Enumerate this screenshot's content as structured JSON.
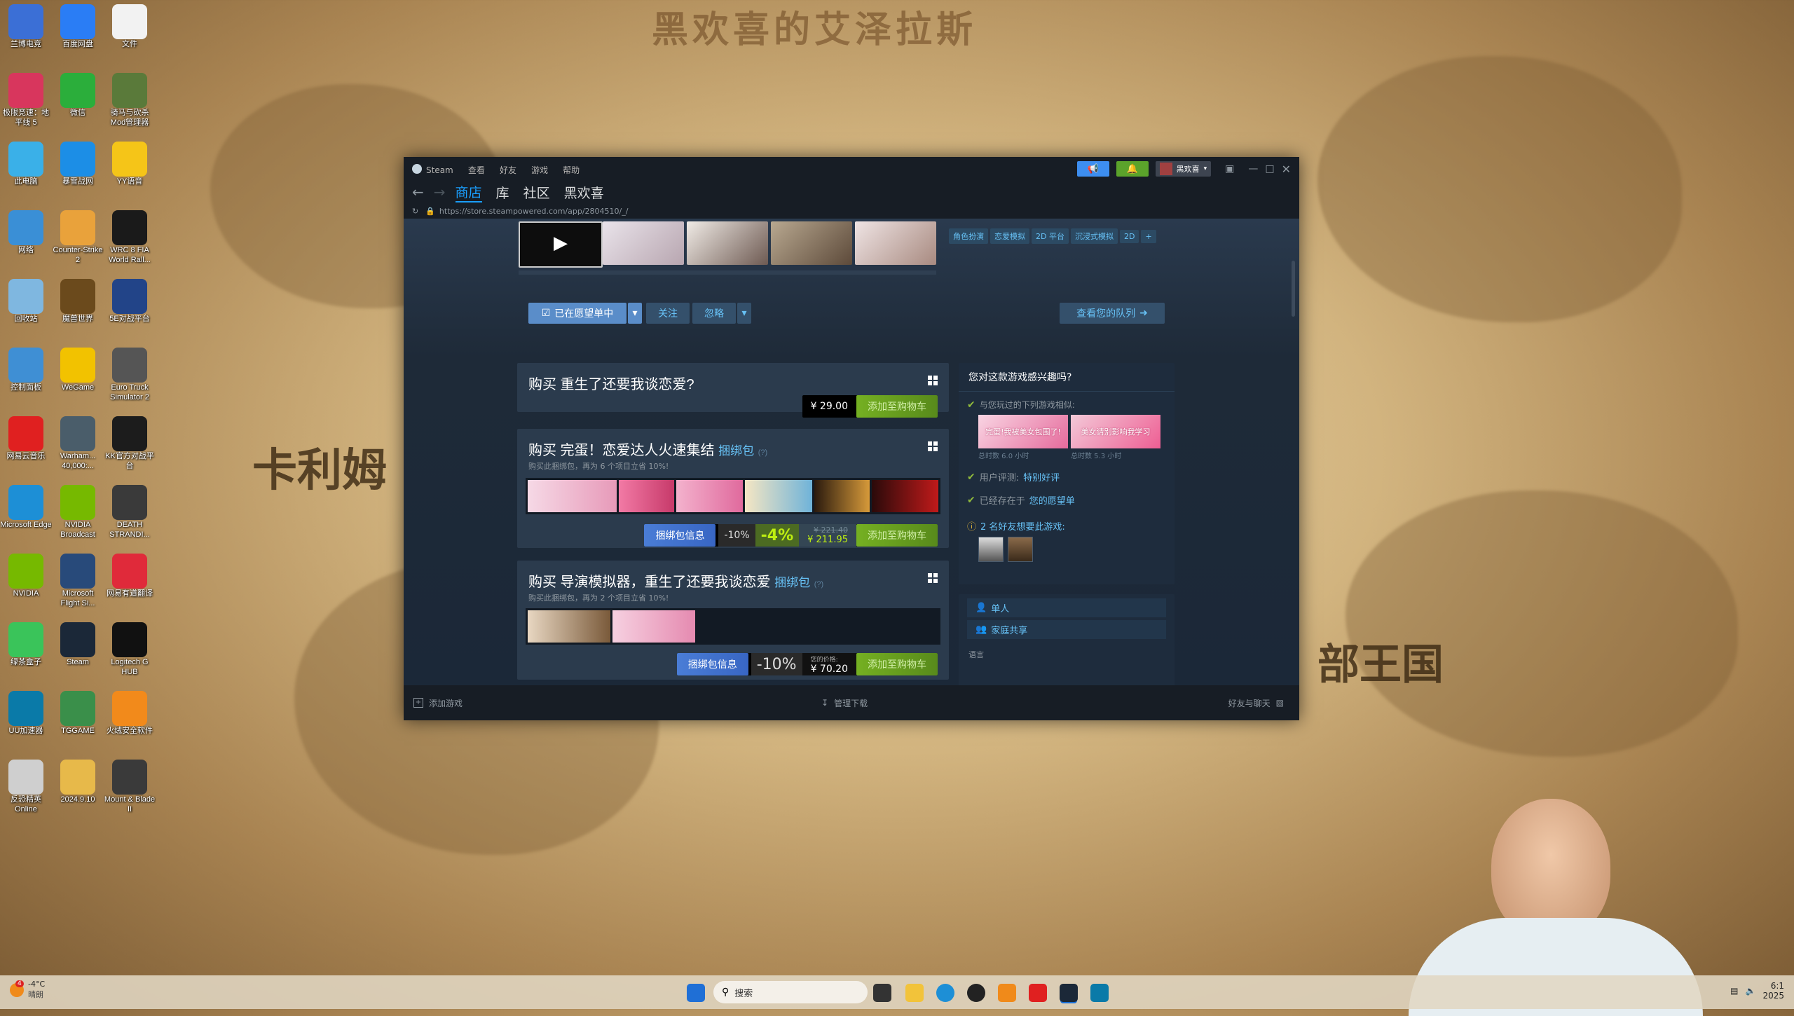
{
  "wallpaper": {
    "banner": "黑欢喜的艾泽拉斯",
    "map_labels": [
      "卡利姆",
      "部王国"
    ]
  },
  "desktop_icons": [
    {
      "label": "兰博电竞",
      "icon": "game-icon",
      "color": "#3b6fd6"
    },
    {
      "label": "百度网盘",
      "icon": "cloud-icon",
      "color": "#2a7df5"
    },
    {
      "label": "文件",
      "icon": "document-icon",
      "color": "#f2f2f2"
    },
    {
      "label": "极限竞速：地平线 5",
      "icon": "forza-icon",
      "color": "#d8365d"
    },
    {
      "label": "微信",
      "icon": "wechat-icon",
      "color": "#2bae3b"
    },
    {
      "label": "骑马与砍杀Mod管理器",
      "icon": "mod-icon",
      "color": "#5a7a3a"
    },
    {
      "label": "此电脑",
      "icon": "computer-icon",
      "color": "#3ab0e8"
    },
    {
      "label": "暴雪战网",
      "icon": "battlenet-icon",
      "color": "#1c8ee6"
    },
    {
      "label": "YY语音",
      "icon": "yy-icon",
      "color": "#f5c518"
    },
    {
      "label": "网络",
      "icon": "network-icon",
      "color": "#3a8fd6"
    },
    {
      "label": "Counter-Strike 2",
      "icon": "cs2-icon",
      "color": "#e9a23b"
    },
    {
      "label": "WRC 8 FIA World Rall...",
      "icon": "wrc-icon",
      "color": "#1a1a1a"
    },
    {
      "label": "回收站",
      "icon": "recycle-bin-icon",
      "color": "#7fb7e0"
    },
    {
      "label": "魔兽世界",
      "icon": "wow-icon",
      "color": "#6b4a1c"
    },
    {
      "label": "5E对战平台",
      "icon": "5e-icon",
      "color": "#224488"
    },
    {
      "label": "控制面板",
      "icon": "control-panel-icon",
      "color": "#3f8fd4"
    },
    {
      "label": "WeGame",
      "icon": "wegame-icon",
      "color": "#f2c200"
    },
    {
      "label": "Euro Truck Simulator 2",
      "icon": "truck-icon",
      "color": "#555"
    },
    {
      "label": "网易云音乐",
      "icon": "netease-music-icon",
      "color": "#e02020"
    },
    {
      "label": "Warham... 40,000:...",
      "icon": "warhammer-icon",
      "color": "#4a5d6a"
    },
    {
      "label": "KK官方对战平台",
      "icon": "kk-icon",
      "color": "#1c1c1c"
    },
    {
      "label": "Microsoft Edge",
      "icon": "edge-icon",
      "color": "#1d8fd6"
    },
    {
      "label": "NVIDIA Broadcast",
      "icon": "nvidia-broadcast-icon",
      "color": "#76b900"
    },
    {
      "label": "DEATH STRANDI...",
      "icon": "death-stranding-icon",
      "color": "#3a3a3a"
    },
    {
      "label": "NVIDIA",
      "icon": "nvidia-icon",
      "color": "#76b900"
    },
    {
      "label": "Microsoft Flight Si...",
      "icon": "flight-sim-icon",
      "color": "#284a7a"
    },
    {
      "label": "网易有道翻译",
      "icon": "youdao-icon",
      "color": "#e02a3a"
    },
    {
      "label": "绿茶盒子",
      "icon": "box-icon",
      "color": "#3ac45a"
    },
    {
      "label": "Steam",
      "icon": "steam-icon",
      "color": "#1b2838"
    },
    {
      "label": "Logitech G HUB",
      "icon": "logitech-icon",
      "color": "#111"
    },
    {
      "label": "UU加速器",
      "icon": "uu-icon",
      "color": "#0a7aa8"
    },
    {
      "label": "TGGAME",
      "icon": "tggame-icon",
      "color": "#3a8f4a"
    },
    {
      "label": "火绒安全软件",
      "icon": "huorong-icon",
      "color": "#f28a1b"
    },
    {
      "label": "反恐精英Online",
      "icon": "cso-icon",
      "color": "#cfcfcf"
    },
    {
      "label": "2024.9.10",
      "icon": "folder-icon",
      "color": "#e7b94a"
    },
    {
      "label": "Mount & Blade II",
      "icon": "bannerlord-icon",
      "color": "#3a3a3a"
    }
  ],
  "steam": {
    "menu": [
      "Steam",
      "查看",
      "好友",
      "游戏",
      "帮助"
    ],
    "username": "黑欢喜",
    "nav": [
      "商店",
      "库",
      "社区",
      "黑欢喜"
    ],
    "url": "https://store.steampowered.com/app/2804510/_/",
    "tags": [
      "角色扮演",
      "恋爱模拟",
      "2D 平台",
      "沉浸式模拟",
      "2D",
      "+"
    ],
    "queue": {
      "wishlist": "已在愿望单中",
      "follow": "关注",
      "ignore": "忽略",
      "view_queue": "查看您的队列"
    },
    "buy1": {
      "title": "购买 重生了还要我谈恋爱?",
      "price": "¥ 29.00",
      "cart": "添加至购物车"
    },
    "buy2": {
      "title": "购买 完蛋！恋爱达人火速集结",
      "bundle": "捆绑包",
      "question": "(?)",
      "sub": "购买此捆绑包，再为 6 个项目立省 10%!",
      "info": "捆绑包信息",
      "base_disc": "-10%",
      "disc": "-4%",
      "orig": "¥ 221.40",
      "price": "¥ 211.95",
      "cart": "添加至购物车"
    },
    "buy3": {
      "title": "购买 导演模拟器，重生了还要我谈恋爱",
      "bundle": "捆绑包",
      "question": "(?)",
      "sub": "购买此捆绑包，再为 2 个项目立省 10%!",
      "info": "捆绑包信息",
      "disc": "-10%",
      "price_label": "您的价格:",
      "price": "¥ 70.20",
      "cart": "添加至购物车"
    },
    "side": {
      "title": "您对这款游戏感兴趣吗?",
      "similar": "与您玩过的下列游戏相似:",
      "g1_time": "总时数 6.0 小时",
      "g2_time": "总时数 5.3 小时",
      "g1_name": "完蛋!我被美女包围了!",
      "g2_name": "美女请别影响我学习",
      "review_label": "用户评测:",
      "review_value": "特别好评",
      "wish_prefix": "已经存在于",
      "wish_link": "您的愿望单",
      "friends": "2 名好友想要此游戏:",
      "single": "单人",
      "family": "家庭共享",
      "lang": "语言"
    },
    "footer": {
      "add": "添加游戏",
      "downloads": "管理下载",
      "friends": "好友与聊天"
    }
  },
  "taskbar": {
    "weather_temp": "-4°C",
    "weather_desc": "晴朗",
    "search": "搜索",
    "badge": "4",
    "time": "6:1",
    "date": "2025"
  }
}
